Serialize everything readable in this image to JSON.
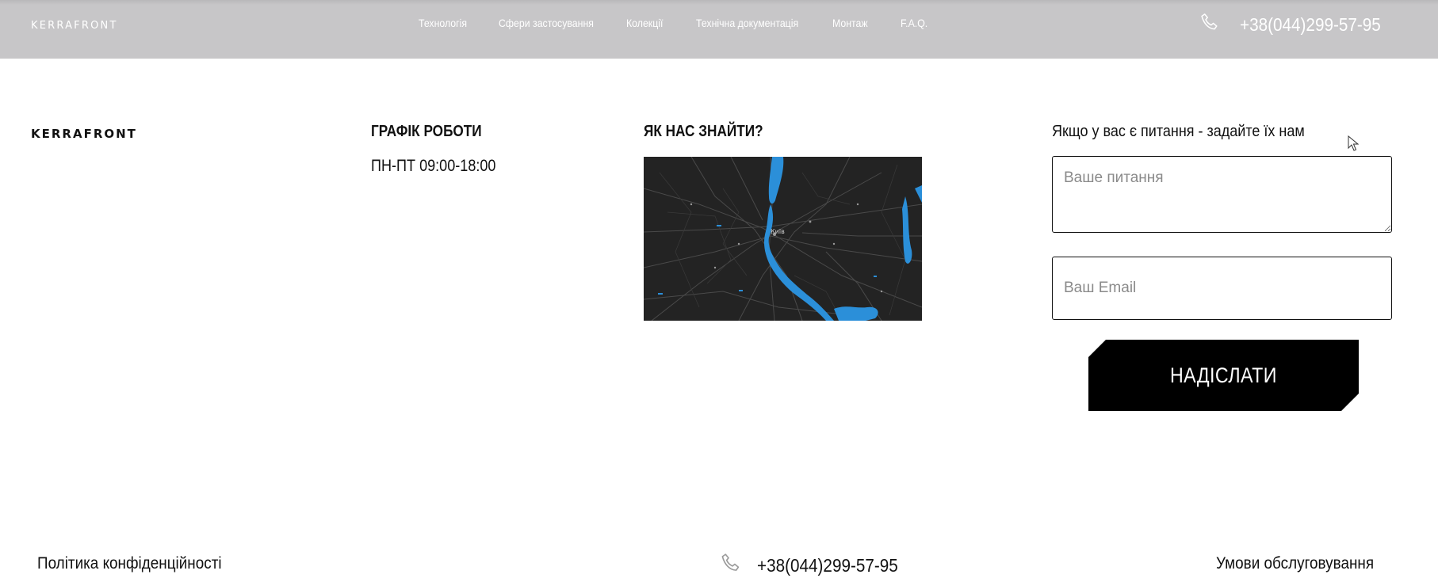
{
  "header": {
    "logo": "KERRAFRONT",
    "nav": [
      {
        "label": "Технологія"
      },
      {
        "label": "Сфери застосування"
      },
      {
        "label": "Колекції"
      },
      {
        "label": "Технічна документація"
      },
      {
        "label": "Монтаж"
      },
      {
        "label": "F.A.Q."
      }
    ],
    "phone": "+38(044)299-57-95"
  },
  "main": {
    "logo": "KERRAFRONT",
    "schedule": {
      "title": "ГРАФІК РОБОТИ",
      "hours": "ПН-ПТ 09:00-18:00"
    },
    "location": {
      "title": "ЯК НАС ЗНАЙТИ?",
      "map_label": "Київ"
    },
    "form": {
      "title": "Якщо у вас є питання - задайте їх нам",
      "question_placeholder": "Ваше питання",
      "email_placeholder": "Ваш Email",
      "submit_label": "НАДІСЛАТИ"
    }
  },
  "footer": {
    "privacy": "Політика конфіденційності",
    "phone": "+38(044)299-57-95",
    "terms": "Умови обслуговування"
  },
  "colors": {
    "header_bg": "#c7c6c8",
    "map_bg": "#232323",
    "map_water": "#2b8fd9",
    "button_bg": "#000000"
  }
}
